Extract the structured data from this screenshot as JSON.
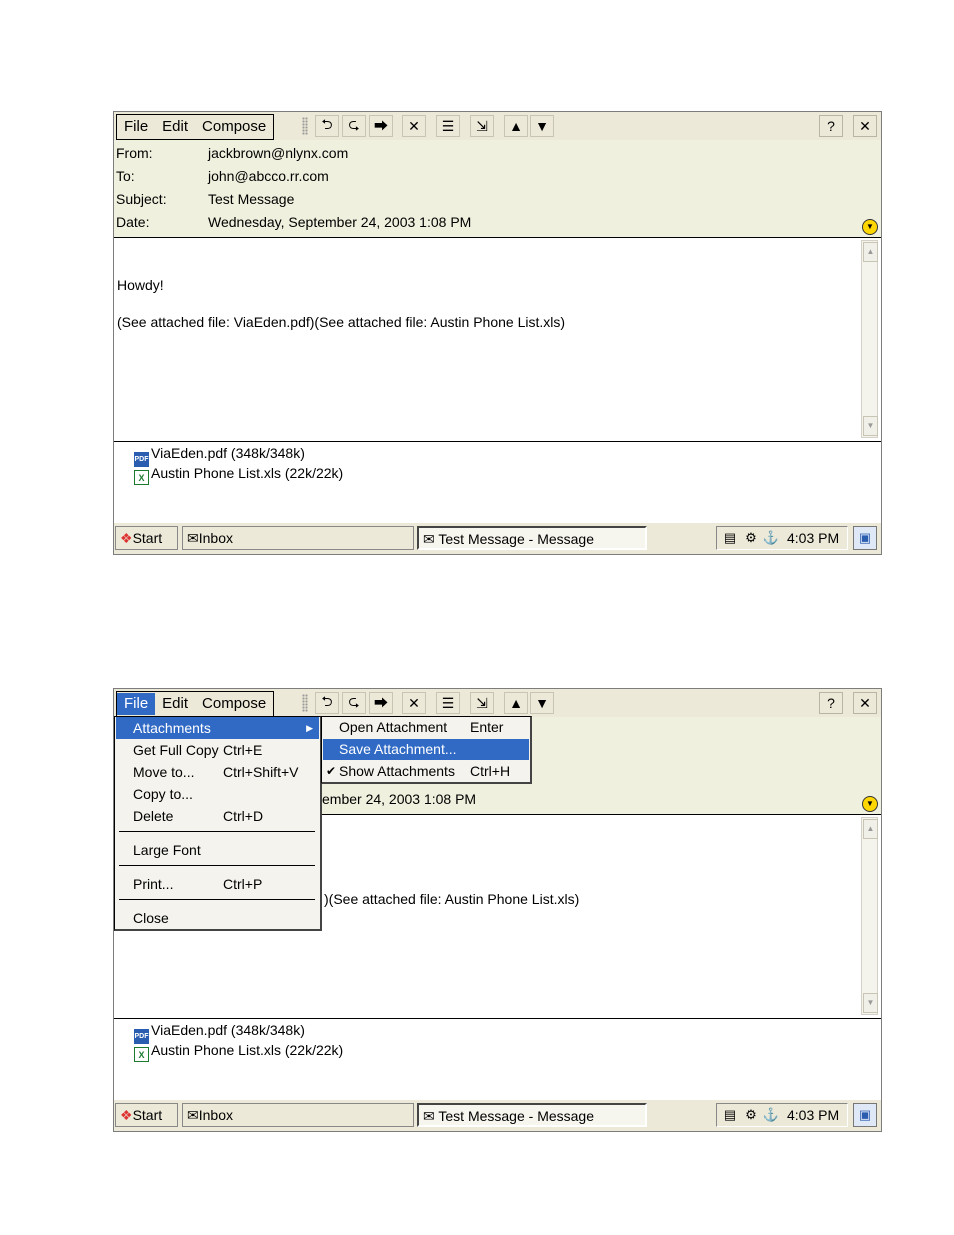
{
  "menu": {
    "file": "File",
    "edit": "Edit",
    "compose": "Compose"
  },
  "toolbar": {
    "icons": [
      "reply-icon",
      "reply-all-icon",
      "forward-icon",
      "delete-icon",
      "message-list-icon",
      "move-icon",
      "previous-icon",
      "next-icon",
      "help-icon",
      "close-icon"
    ]
  },
  "header": {
    "from_label": "From:",
    "from_value": "jackbrown@nlynx.com",
    "to_label": "To:",
    "to_value": "john@abcco.rr.com",
    "subject_label": "Subject:",
    "subject_value": "Test Message",
    "date_label": "Date:",
    "date_value": "Wednesday, September 24, 2003 1:08 PM",
    "date_value_partial": "ember 24, 2003 1:08 PM"
  },
  "body": {
    "line1": "Howdy!",
    "line2": "(See attached file: ViaEden.pdf)(See attached file: Austin Phone List.xls)",
    "line2_partial": ")(See attached file: Austin Phone List.xls)"
  },
  "attachments": [
    {
      "name": "ViaEden.pdf (348k/348k)",
      "icon": "pdf-file-icon"
    },
    {
      "name": "Austin Phone List.xls (22k/22k)",
      "icon": "excel-file-icon"
    }
  ],
  "taskbar": {
    "start": "Start",
    "inbox": "Inbox",
    "active_window": "Test Message - Message",
    "clock": "4:03 PM"
  },
  "file_menu": {
    "items": [
      {
        "label": "Attachments",
        "accel": "",
        "highlighted": true
      },
      {
        "label": "Get Full Copy",
        "accel": "Ctrl+E"
      },
      {
        "label": "Move to...",
        "accel": "Ctrl+Shift+V"
      },
      {
        "label": "Copy to...",
        "accel": ""
      },
      {
        "label": "Delete",
        "accel": "Ctrl+D"
      },
      {
        "label": "Large Font",
        "accel": ""
      },
      {
        "label": "Print...",
        "accel": "Ctrl+P"
      },
      {
        "label": "Close",
        "accel": ""
      }
    ]
  },
  "attachments_submenu": {
    "items": [
      {
        "label": "Open Attachment",
        "accel": "Enter"
      },
      {
        "label": "Save Attachment...",
        "accel": "",
        "highlighted": true
      },
      {
        "label": "Show Attachments",
        "accel": "Ctrl+H",
        "checked": true
      }
    ]
  },
  "colors": {
    "menu_highlight": "#316ac5",
    "chrome": "#ece9d8",
    "header_bg": "#f0f0de"
  }
}
